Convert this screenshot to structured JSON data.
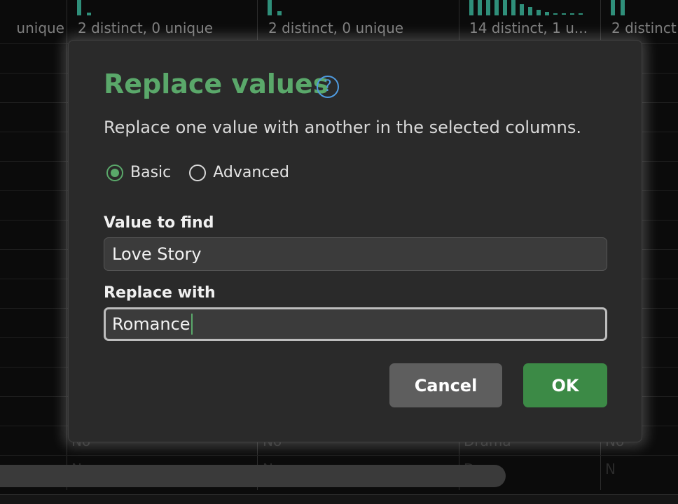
{
  "background": {
    "column_stats": [
      "unique",
      "2 distinct, 0 unique",
      "2 distinct, 0 unique",
      "14 distinct, 1 u...",
      "2 distinct"
    ],
    "ghost_cells": [
      "No",
      "No",
      "Drama",
      "No",
      "N",
      "N",
      "D",
      "N"
    ]
  },
  "dialog": {
    "title": "Replace values",
    "help_icon": "question-circle-icon",
    "subtitle": "Replace one value with another in the selected columns.",
    "mode_options": [
      {
        "label": "Basic",
        "selected": true
      },
      {
        "label": "Advanced",
        "selected": false
      }
    ],
    "find_label": "Value to find",
    "find_value": "Love Story",
    "replace_label": "Replace with",
    "replace_value": "Romance",
    "cancel_label": "Cancel",
    "ok_label": "OK"
  },
  "colors": {
    "accent": "#5aa86a",
    "ok_button": "#3c8a46",
    "cancel_button": "#5e5e5e",
    "help_icon": "#4f9be0",
    "histogram": "#2f8f7a"
  }
}
